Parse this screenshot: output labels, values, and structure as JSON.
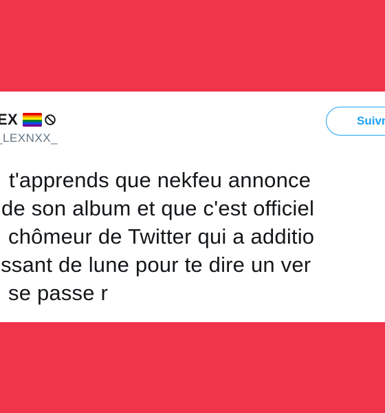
{
  "tweet": {
    "display_name": "EX",
    "handle": "_LEXNXX_",
    "follow_label": "Suivr",
    "text_lines": [
      "t'apprends que nekfeu annonce",
      "de son album et que c'est officiel",
      "chômeur de Twitter qui a additio",
      "issant de lune pour te dire un ver",
      "se passe r"
    ]
  },
  "icons": {
    "flag": "rainbow-flag-icon",
    "badge": "no-entry-icon"
  },
  "colors": {
    "background": "#f0344a",
    "card": "#ffffff",
    "follow_accent": "#1da1f2",
    "handle": "#657786"
  }
}
